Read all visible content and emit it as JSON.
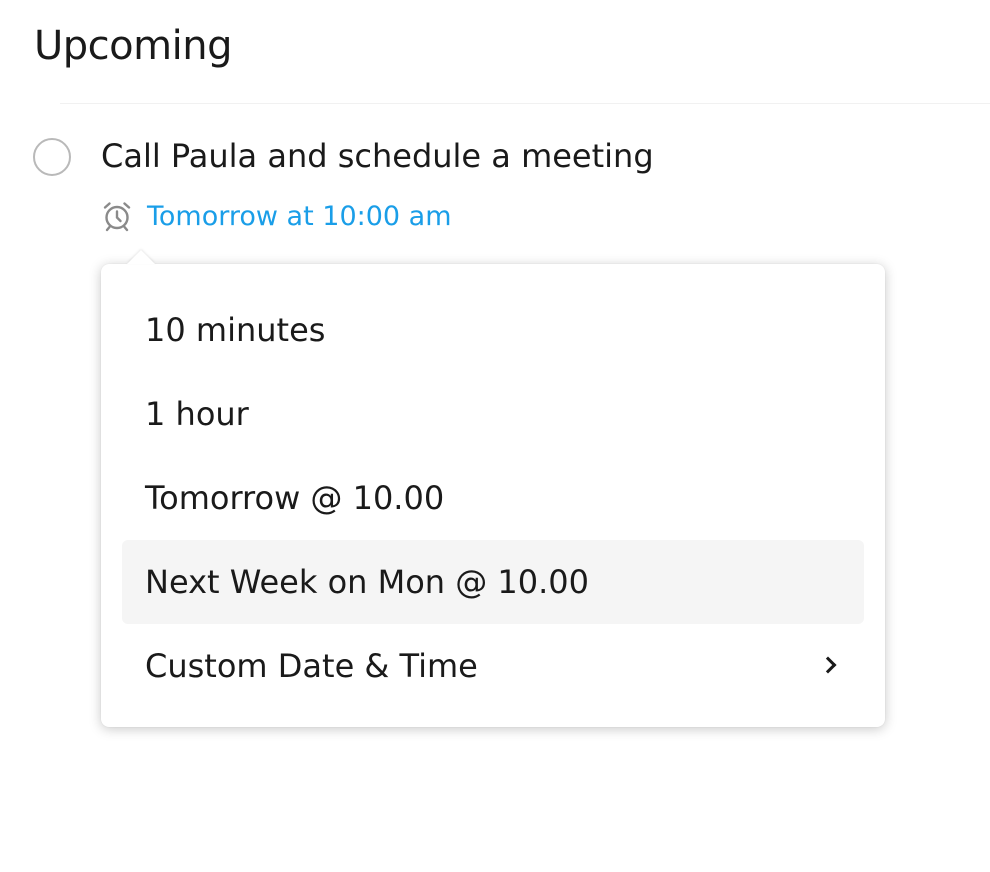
{
  "section": {
    "title": "Upcoming"
  },
  "task": {
    "title": "Call Paula and schedule a meeting",
    "reminder_label": "Tomorrow at 10:00 am",
    "reminder_icon": "alarm-clock-icon"
  },
  "snooze_menu": {
    "items": [
      {
        "label": "10 minutes"
      },
      {
        "label": "1 hour"
      },
      {
        "label": "Tomorrow @ 10.00"
      },
      {
        "label": "Next Week on Mon @ 10.00"
      },
      {
        "label": "Custom Date & Time"
      }
    ],
    "highlighted_item": "Next Week on Mon @ 10.00",
    "submenu_icon": "chevron-right-icon"
  },
  "colors": {
    "link": "#1a9ee8",
    "text": "#1a1a1a",
    "hover": "#f5f5f5",
    "checkbox_border": "#b9b9b9"
  }
}
